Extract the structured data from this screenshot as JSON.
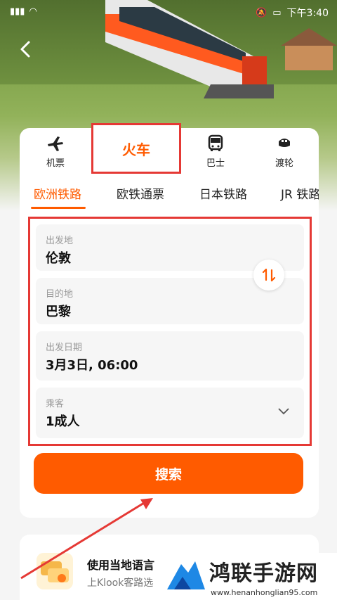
{
  "status_bar": {
    "time": "下午3:40"
  },
  "transport_modes": [
    {
      "label": "机票",
      "icon": "airplane-icon"
    },
    {
      "label": "火车",
      "icon": "train-icon"
    },
    {
      "label": "巴士",
      "icon": "bus-icon"
    },
    {
      "label": "渡轮",
      "icon": "ferry-icon"
    }
  ],
  "sub_tabs": [
    "欧洲铁路",
    "欧铁通票",
    "日本铁路",
    "JR 铁路"
  ],
  "form": {
    "from": {
      "label": "出发地",
      "value": "伦敦"
    },
    "to": {
      "label": "目的地",
      "value": "巴黎"
    },
    "date": {
      "label": "出发日期",
      "value": "3月3日, 06:00"
    },
    "passengers": {
      "label": "乘客",
      "value": "1成人"
    }
  },
  "search_button": "搜索",
  "promo": {
    "title": "使用当地语言",
    "subtitle": "上Klook客路选"
  },
  "watermark": {
    "title": "鸿联手游网",
    "url": "www.henanhonglian95.com"
  },
  "colors": {
    "accent": "#ff5b00",
    "highlight_border": "#e53935"
  }
}
